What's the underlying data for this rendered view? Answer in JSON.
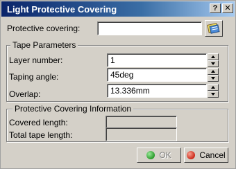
{
  "window": {
    "title": "Light Protective Covering",
    "help_button": "?",
    "close_button": "✕"
  },
  "protective_covering": {
    "label": "Protective covering:",
    "value": "",
    "browse_icon": "catalog-browse-icon"
  },
  "tape_parameters": {
    "title": "Tape Parameters",
    "layer_number": {
      "label": "Layer number:",
      "value": "1"
    },
    "taping_angle": {
      "label": "Taping angle:",
      "value": "45deg"
    },
    "overlap": {
      "label": "Overlap:",
      "value": "13.336mm"
    }
  },
  "info": {
    "title": "Protective Covering Information",
    "covered_length": {
      "label": "Covered length:",
      "value": ""
    },
    "total_tape_length": {
      "label": "Total tape length:",
      "value": ""
    }
  },
  "buttons": {
    "ok": {
      "label": "OK",
      "icon": "ok-icon",
      "color": "#2a9a2a",
      "enabled": false
    },
    "cancel": {
      "label": "Cancel",
      "icon": "cancel-icon",
      "color": "#cc2a1a"
    }
  },
  "colors": {
    "titlebar_start": "#0a246a",
    "titlebar_end": "#a6caf0",
    "dialog_bg": "#d4d0c8"
  }
}
